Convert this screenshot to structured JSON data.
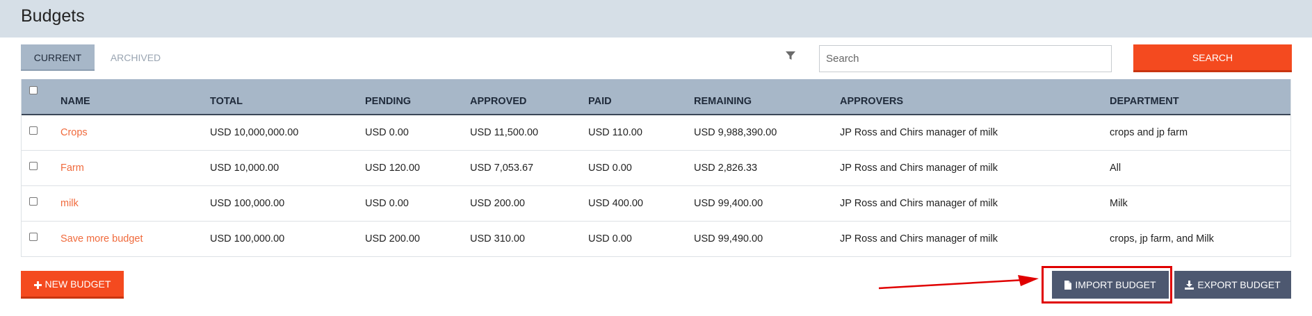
{
  "header": {
    "title": "Budgets"
  },
  "tabs": [
    {
      "label": "CURRENT",
      "active": true
    },
    {
      "label": "ARCHIVED",
      "active": false
    }
  ],
  "search": {
    "placeholder": "Search",
    "button_label": "SEARCH"
  },
  "table": {
    "columns": [
      "NAME",
      "TOTAL",
      "PENDING",
      "APPROVED",
      "PAID",
      "REMAINING",
      "APPROVERS",
      "DEPARTMENT"
    ],
    "rows": [
      {
        "name": "Crops",
        "total": "USD 10,000,000.00",
        "pending": "USD 0.00",
        "approved": "USD 11,500.00",
        "paid": "USD 110.00",
        "remaining": "USD 9,988,390.00",
        "approvers": "JP Ross and Chirs manager of milk",
        "department": "crops and jp farm"
      },
      {
        "name": "Farm",
        "total": "USD 10,000.00",
        "pending": "USD 120.00",
        "approved": "USD 7,053.67",
        "paid": "USD 0.00",
        "remaining": "USD 2,826.33",
        "approvers": "JP Ross and Chirs manager of milk",
        "department": "All"
      },
      {
        "name": "milk",
        "total": "USD 100,000.00",
        "pending": "USD 0.00",
        "approved": "USD 200.00",
        "paid": "USD 400.00",
        "remaining": "USD 99,400.00",
        "approvers": "JP Ross and Chirs manager of milk",
        "department": "Milk"
      },
      {
        "name": "Save more budget",
        "total": "USD 100,000.00",
        "pending": "USD 200.00",
        "approved": "USD 310.00",
        "paid": "USD 0.00",
        "remaining": "USD 99,490.00",
        "approvers": "JP Ross and Chirs manager of milk",
        "department": "crops, jp farm, and Milk"
      }
    ]
  },
  "actions": {
    "new_budget": "NEW BUDGET",
    "import_budget": "IMPORT BUDGET",
    "export_budget": "EXPORT BUDGET"
  },
  "icons": {
    "filter": "filter-icon",
    "plus": "plus-icon",
    "file": "file-icon",
    "download": "download-icon"
  },
  "colors": {
    "accent": "#f44a1f",
    "header_bg": "#d6dfe7",
    "table_header_bg": "#a7b7c8",
    "dark_button": "#4d5870",
    "link": "#f06a3c",
    "annotation": "#e00000"
  }
}
